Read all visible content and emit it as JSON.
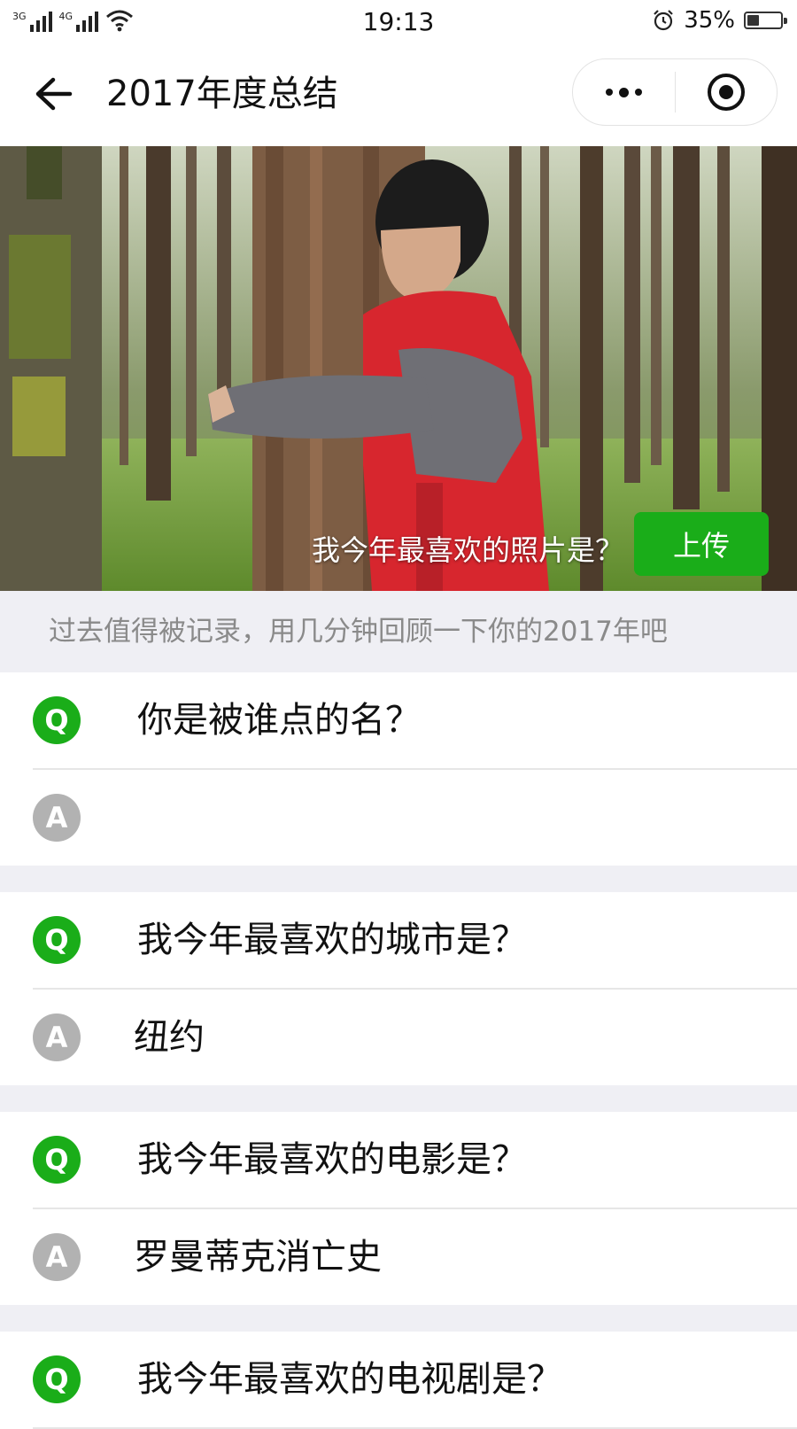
{
  "status_bar": {
    "network1": "3G",
    "network2": "4G",
    "time": "19:13",
    "battery_percent": "35%",
    "battery_level": 0.35,
    "icons": [
      "signal-icon",
      "signal-icon",
      "wifi-icon",
      "alarm-icon",
      "battery-icon"
    ]
  },
  "nav": {
    "back_icon": "arrow-left-icon",
    "title": "2017年度总结",
    "more_icon": "more-dots-icon",
    "close_icon": "target-close-icon"
  },
  "banner": {
    "question": "我今年最喜欢的照片是？",
    "upload_label": "上传"
  },
  "intro": {
    "text": "过去值得被记录，用几分钟回顾一下你的2017年吧"
  },
  "qa": [
    {
      "q_badge": "Q",
      "question": "你是被谁点的名？",
      "a_badge": "A",
      "answer": ""
    },
    {
      "q_badge": "Q",
      "question": "我今年最喜欢的城市是？",
      "a_badge": "A",
      "answer": "纽约"
    },
    {
      "q_badge": "Q",
      "question": "我今年最喜欢的电影是？",
      "a_badge": "A",
      "answer": "罗曼蒂克消亡史"
    },
    {
      "q_badge": "Q",
      "question": "我今年最喜欢的电视剧是？",
      "a_badge": "A",
      "answer": ""
    }
  ],
  "colors": {
    "accent_green": "#1aad19",
    "answer_grey": "#b2b2b2",
    "background_grey": "#efeff4"
  }
}
